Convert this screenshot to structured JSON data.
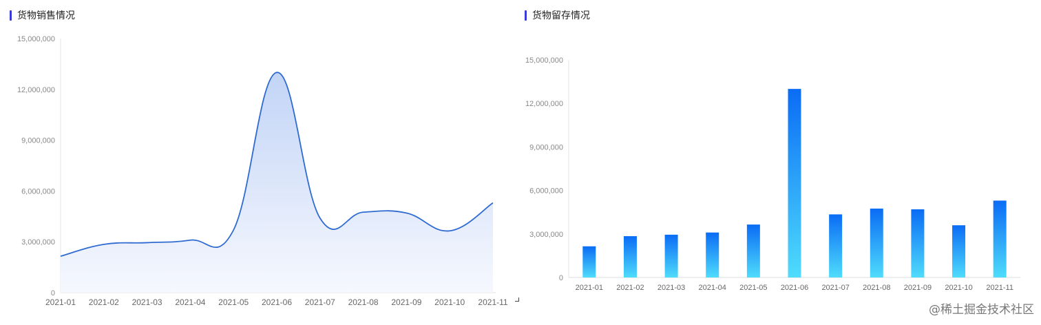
{
  "chart_data": [
    {
      "type": "area",
      "title": "货物销售情况",
      "categories": [
        "2021-01",
        "2021-02",
        "2021-03",
        "2021-04",
        "2021-05",
        "2021-06",
        "2021-07",
        "2021-08",
        "2021-09",
        "2021-10",
        "2021-11"
      ],
      "values": [
        2150000,
        2850000,
        2950000,
        3100000,
        3700000,
        13000000,
        4400000,
        4750000,
        4700000,
        3650000,
        5300000
      ],
      "ylim": [
        0,
        15000000
      ],
      "yticks": [
        "0",
        "3,000,000",
        "6,000,000",
        "9,000,000",
        "12,000,000",
        "15,000,000"
      ],
      "line_color": "#2e6ad1",
      "fill_top": "#c2d4f6",
      "fill_bottom": "#f6f8fe"
    },
    {
      "type": "bar",
      "title": "货物留存情况",
      "categories": [
        "2021-01",
        "2021-02",
        "2021-03",
        "2021-04",
        "2021-05",
        "2021-06",
        "2021-07",
        "2021-08",
        "2021-09",
        "2021-10",
        "2021-11"
      ],
      "values": [
        2150000,
        2850000,
        2950000,
        3100000,
        3650000,
        13000000,
        4350000,
        4750000,
        4700000,
        3600000,
        5300000
      ],
      "ylim": [
        0,
        15000000
      ],
      "yticks": [
        "0",
        "3,000,000",
        "6,000,000",
        "9,000,000",
        "12,000,000",
        "15,000,000"
      ],
      "bar_top": "#0a6cf5",
      "bar_bottom": "#4fdcfc"
    }
  ],
  "watermark": "@稀土掘金技术社区"
}
